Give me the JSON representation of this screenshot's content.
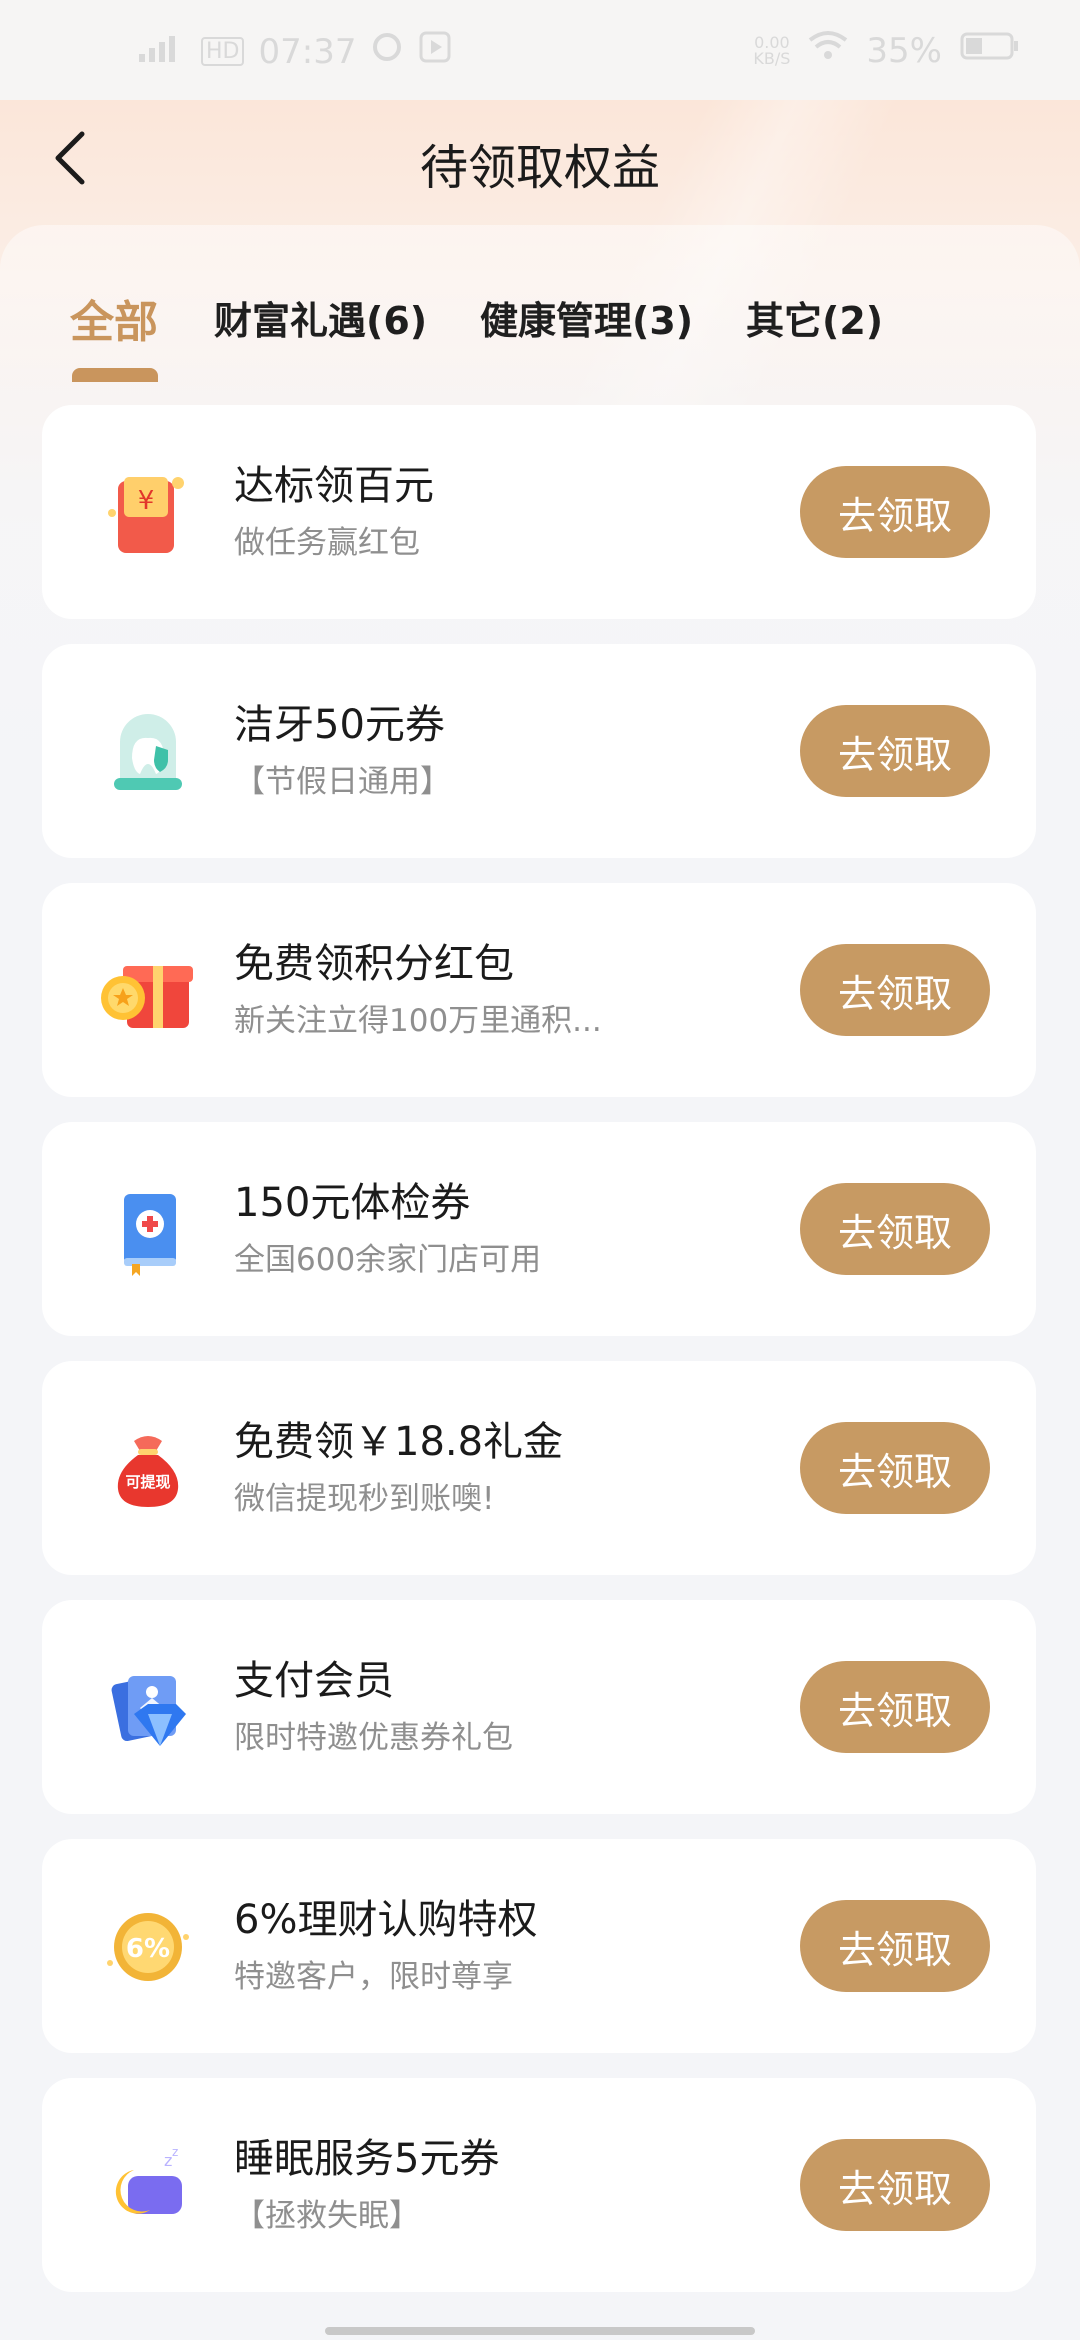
{
  "status_bar": {
    "signal": "4G",
    "hd": "HD",
    "time": "07:37",
    "network_speed": "0.00\nKB/S",
    "battery": "35%"
  },
  "header": {
    "title": "待领取权益"
  },
  "tabs": [
    {
      "label": "全部",
      "active": true
    },
    {
      "label": "财富礼遇(6)",
      "active": false
    },
    {
      "label": "健康管理(3)",
      "active": false
    },
    {
      "label": "其它(2)",
      "active": false
    }
  ],
  "benefits": [
    {
      "title": "达标领百元",
      "subtitle": "做任务赢红包",
      "button": "去领取",
      "icon": "red-envelope-icon"
    },
    {
      "title": "洁牙50元券",
      "subtitle": "【节假日通用】",
      "button": "去领取",
      "icon": "tooth-icon"
    },
    {
      "title": "免费领积分红包",
      "subtitle": "新关注立得100万里通积...",
      "button": "去领取",
      "icon": "gift-box-icon"
    },
    {
      "title": "150元体检券",
      "subtitle": "全国600余家门店可用",
      "button": "去领取",
      "icon": "medical-book-icon"
    },
    {
      "title": "免费领￥18.8礼金",
      "subtitle": "微信提现秒到账噢!",
      "button": "去领取",
      "icon": "money-bag-icon",
      "icon_text": "可提现"
    },
    {
      "title": "支付会员",
      "subtitle": "限时特邀优惠券礼包",
      "button": "去领取",
      "icon": "diamond-card-icon"
    },
    {
      "title": "6%理财认购特权",
      "subtitle": "特邀客户，限时尊享",
      "button": "去领取",
      "icon": "coin-icon",
      "icon_text": "6%"
    },
    {
      "title": "睡眠服务5元券",
      "subtitle": "【拯救失眠】",
      "button": "去领取",
      "icon": "sleep-moon-icon"
    }
  ],
  "colors": {
    "accent": "#c79a63",
    "tab_active": "#c9955d",
    "title_text": "#1b1b1b",
    "sub_text": "#8f8f8f"
  }
}
